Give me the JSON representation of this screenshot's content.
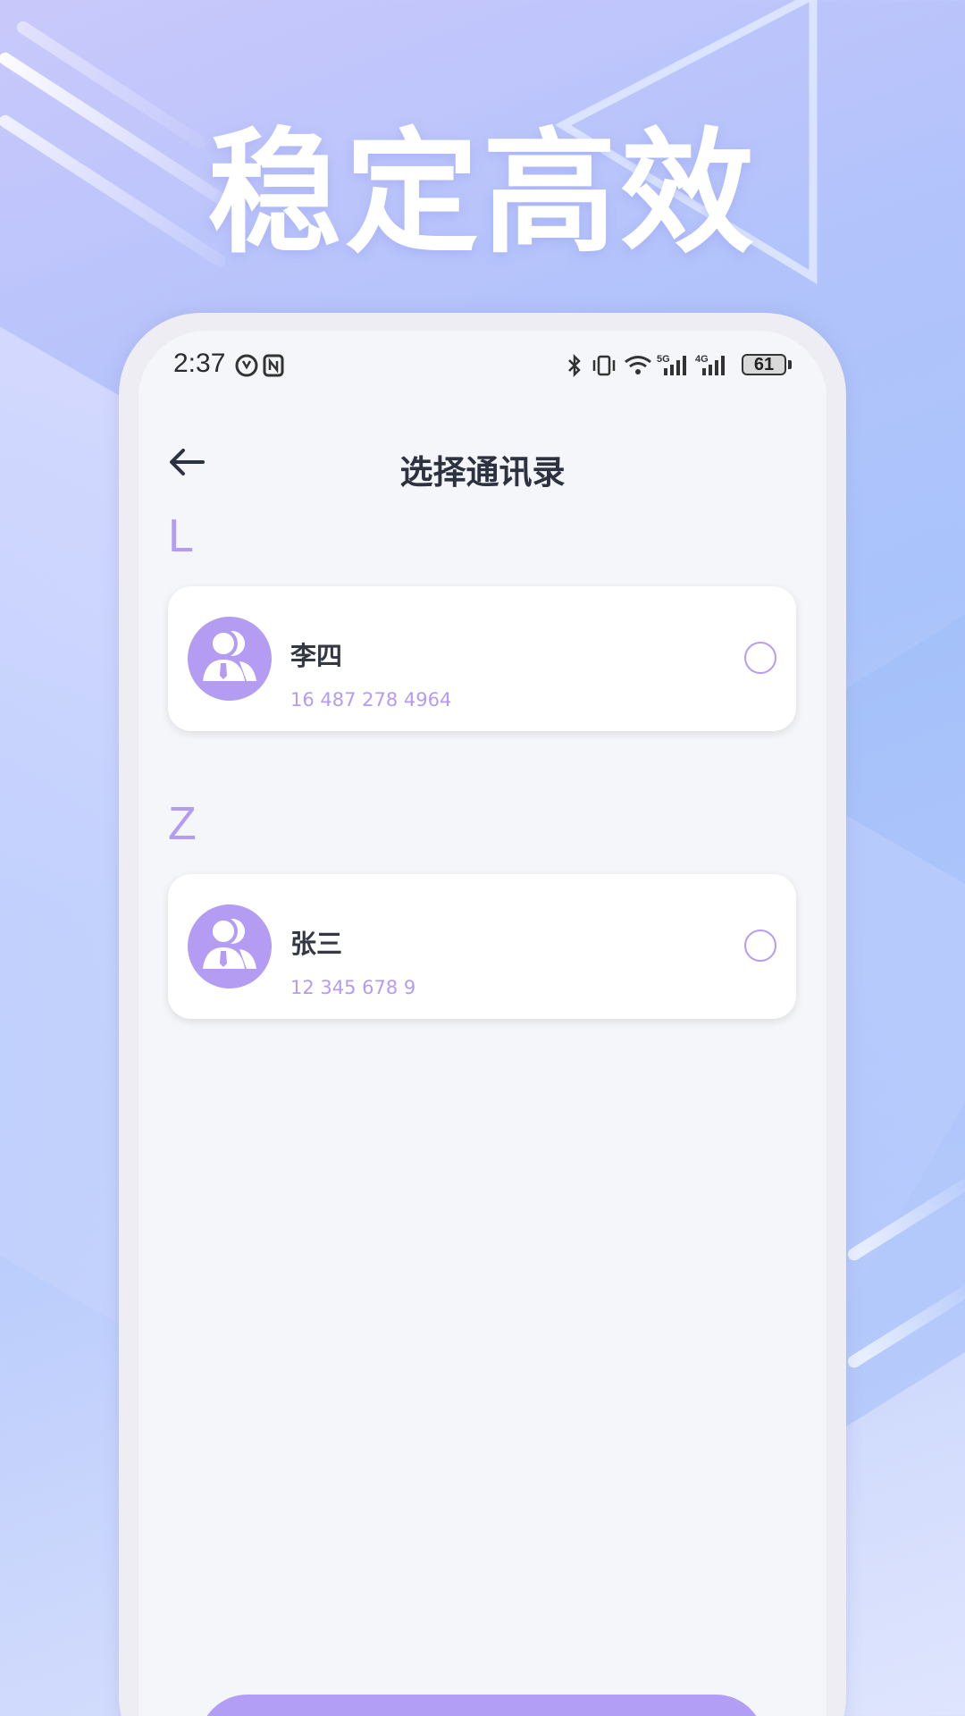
{
  "promo": {
    "headline": "稳定高效"
  },
  "status_bar": {
    "time": "2:37",
    "battery": "61",
    "icons": [
      "data-saver-icon",
      "nfc-icon",
      "bluetooth-icon",
      "vibrate-icon",
      "wifi-icon",
      "signal-5g-icon",
      "signal-4g-icon",
      "battery-icon"
    ]
  },
  "nav": {
    "back_icon": "arrow-left-icon",
    "title": "选择通讯录"
  },
  "sections": [
    {
      "letter": "L",
      "contacts": [
        {
          "name": "李四",
          "phone": "16 487 278 4964",
          "selected": false
        }
      ]
    },
    {
      "letter": "Z",
      "contacts": [
        {
          "name": "张三",
          "phone": "12 345 678 9",
          "selected": false
        }
      ]
    }
  ],
  "colors": {
    "accent": "#b49cf3",
    "title_text": "#2d3240",
    "screen_bg": "#f5f6f9",
    "card_bg": "#ffffff",
    "button": "#b39ef6"
  }
}
